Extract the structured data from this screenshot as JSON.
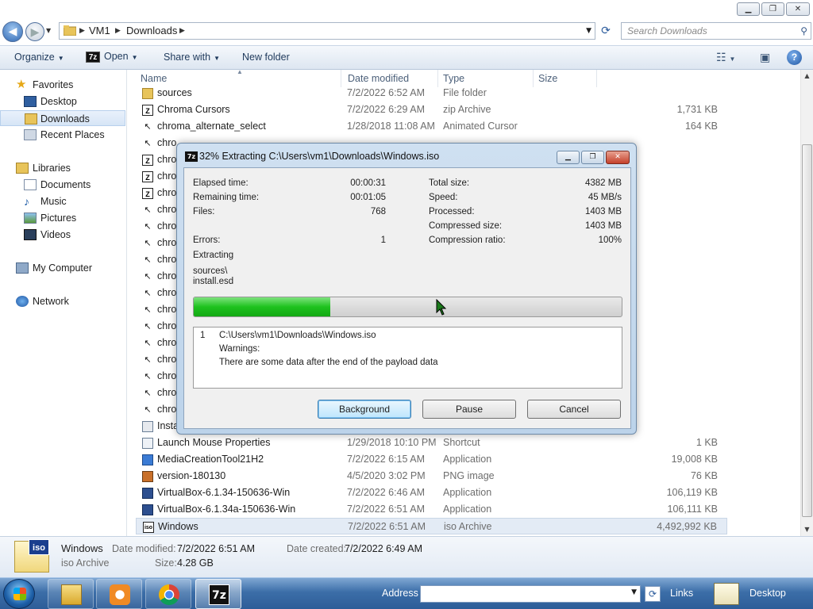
{
  "explorer": {
    "address": {
      "crumbs": [
        "VM1",
        "Downloads"
      ]
    },
    "search_placeholder": "Search Downloads",
    "toolbar": {
      "organize": "Organize",
      "open": "Open",
      "share": "Share with",
      "new_folder": "New folder"
    },
    "nav": {
      "favorites": "Favorites",
      "desktop": "Desktop",
      "downloads": "Downloads",
      "recent": "Recent Places",
      "libraries": "Libraries",
      "documents": "Documents",
      "music": "Music",
      "pictures": "Pictures",
      "videos": "Videos",
      "computer": "My Computer",
      "network": "Network"
    },
    "columns": {
      "name": "Name",
      "date": "Date modified",
      "type": "Type",
      "size": "Size"
    },
    "files": [
      {
        "name": "sources",
        "date": "7/2/2022 6:52 AM",
        "type": "File folder",
        "size": "",
        "icon": "folder-icon"
      },
      {
        "name": "Chroma Cursors",
        "date": "7/2/2022 6:29 AM",
        "type": "zip Archive",
        "size": "1,731 KB",
        "icon": "7z-archive-icon"
      },
      {
        "name": "chroma_alternate_select",
        "date": "1/28/2018 11:08 AM",
        "type": "Animated Cursor",
        "size": "164 KB",
        "icon": "cursor-file-icon"
      },
      {
        "name": "chro",
        "date": "",
        "type": "",
        "size": "",
        "icon": "cursor-file-icon"
      },
      {
        "name": "chro",
        "date": "",
        "type": "",
        "size": "",
        "icon": "7z-archive-icon"
      },
      {
        "name": "chro",
        "date": "",
        "type": "",
        "size": "",
        "icon": "7z-archive-icon"
      },
      {
        "name": "chro",
        "date": "",
        "type": "",
        "size": "",
        "icon": "7z-archive-icon"
      },
      {
        "name": "chro",
        "date": "",
        "type": "",
        "size": "",
        "icon": "cursor-file-icon"
      },
      {
        "name": "chro",
        "date": "",
        "type": "",
        "size": "",
        "icon": "cursor-file-icon"
      },
      {
        "name": "chro",
        "date": "",
        "type": "",
        "size": "",
        "icon": "cursor-file-icon"
      },
      {
        "name": "chro",
        "date": "",
        "type": "",
        "size": "",
        "icon": "cursor-file-icon"
      },
      {
        "name": "chro",
        "date": "",
        "type": "",
        "size": "",
        "icon": "cursor-file-icon"
      },
      {
        "name": "chro",
        "date": "",
        "type": "",
        "size": "",
        "icon": "cursor-file-icon"
      },
      {
        "name": "chro",
        "date": "",
        "type": "",
        "size": "",
        "icon": "cursor-file-icon"
      },
      {
        "name": "chro",
        "date": "",
        "type": "",
        "size": "",
        "icon": "cursor-file-icon"
      },
      {
        "name": "chro",
        "date": "",
        "type": "",
        "size": "",
        "icon": "cursor-file-icon"
      },
      {
        "name": "chro",
        "date": "",
        "type": "",
        "size": "",
        "icon": "cursor-file-icon"
      },
      {
        "name": "chro",
        "date": "",
        "type": "",
        "size": "",
        "icon": "cursor-file-icon"
      },
      {
        "name": "chro",
        "date": "",
        "type": "",
        "size": "",
        "icon": "cursor-file-icon"
      },
      {
        "name": "chro",
        "date": "",
        "type": "",
        "size": "",
        "icon": "cursor-file-icon"
      },
      {
        "name": "Insta",
        "date": "",
        "type": "",
        "size": "",
        "icon": "setup-file-icon"
      },
      {
        "name": "Launch Mouse Properties",
        "date": "1/29/2018 10:10 PM",
        "type": "Shortcut",
        "size": "1 KB",
        "icon": "shortcut-icon"
      },
      {
        "name": "MediaCreationTool21H2",
        "date": "7/2/2022 6:15 AM",
        "type": "Application",
        "size": "19,008 KB",
        "icon": "app-icon"
      },
      {
        "name": "version-180130",
        "date": "4/5/2020 3:02 PM",
        "type": "PNG image",
        "size": "76 KB",
        "icon": "image-icon"
      },
      {
        "name": "VirtualBox-6.1.34-150636-Win",
        "date": "7/2/2022 6:46 AM",
        "type": "Application",
        "size": "106,119 KB",
        "icon": "virtualbox-icon"
      },
      {
        "name": "VirtualBox-6.1.34a-150636-Win",
        "date": "7/2/2022 6:51 AM",
        "type": "Application",
        "size": "106,111 KB",
        "icon": "virtualbox-icon"
      },
      {
        "name": "Windows",
        "date": "7/2/2022 6:51 AM",
        "type": "iso Archive",
        "size": "4,492,992 KB",
        "icon": "iso-icon"
      }
    ],
    "details": {
      "name": "Windows",
      "type": "iso Archive",
      "modified_label": "Date modified:",
      "modified": "7/2/2022 6:51 AM",
      "created_label": "Date created:",
      "created": "7/2/2022 6:49 AM",
      "size_label": "Size:",
      "size": "4.28 GB",
      "icon_label": "iso"
    }
  },
  "dialog": {
    "title": "32% Extracting C:\\Users\\vm1\\Downloads\\Windows.iso",
    "icon_label": "7z",
    "elapsed_label": "Elapsed time:",
    "elapsed": "00:00:31",
    "remaining_label": "Remaining time:",
    "remaining": "00:01:05",
    "files_label": "Files:",
    "files": "768",
    "errors_label": "Errors:",
    "errors": "1",
    "total_label": "Total size:",
    "total": "4382 MB",
    "speed_label": "Speed:",
    "speed": "45 MB/s",
    "processed_label": "Processed:",
    "processed": "1403 MB",
    "compressed_label": "Compressed size:",
    "compressed": "1403 MB",
    "ratio_label": "Compression ratio:",
    "ratio": "100%",
    "extracting_label": "Extracting",
    "current_path": "sources\\",
    "current_file": "install.esd",
    "progress_pct": 32,
    "message": {
      "index": "1",
      "path": "C:\\Users\\vm1\\Downloads\\Windows.iso",
      "warnings": "Warnings:",
      "text": "There are some data after the end of the payload data"
    },
    "buttons": {
      "background": "Background",
      "pause": "Pause",
      "cancel": "Cancel"
    }
  },
  "taskbar": {
    "address_label": "Address",
    "links_label": "Links",
    "desktop_label": "Desktop",
    "app_7z": "7z"
  },
  "colors": {
    "progress": "#1ec21e",
    "taskbar": "#3c6ea8",
    "accent": "#1e395b"
  }
}
